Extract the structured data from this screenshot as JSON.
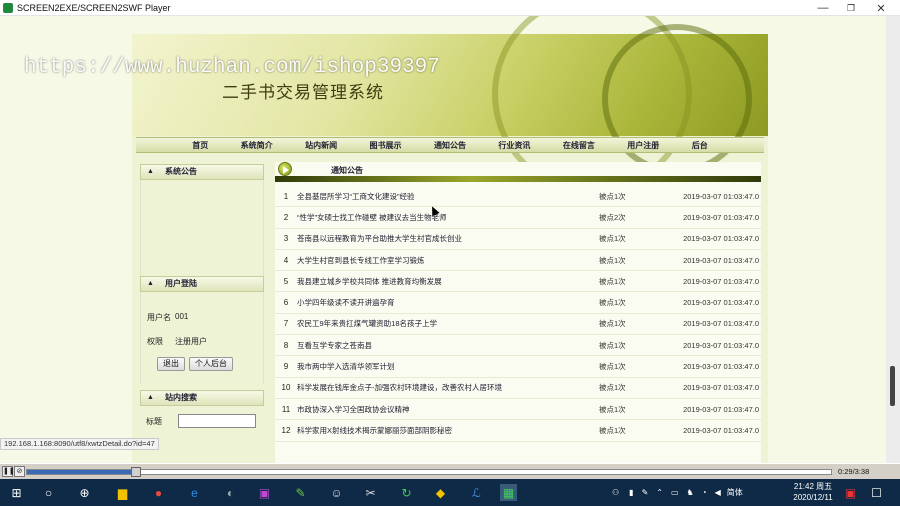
{
  "window": {
    "title": "SCREEN2EXE/SCREEN2SWF Player",
    "minimize": "—",
    "restore": "❐",
    "close": "✕"
  },
  "watermark": "https://www.huzhan.com/ishop39397",
  "site": {
    "title": "二手书交易管理系统"
  },
  "nav": [
    "首页",
    "系统简介",
    "站内新闻",
    "图书展示",
    "通知公告",
    "行业资讯",
    "在线留言",
    "用户注册",
    "后台"
  ],
  "sidebar": {
    "notice_title": "系统公告",
    "login_title": "用户登陆",
    "user_label": "用户名",
    "user_value": "001",
    "role_label": "权限",
    "role_value": "注册用户",
    "logout_button": "退出",
    "personal_button": "个人后台",
    "search_title": "站内搜索",
    "search_label": "标题"
  },
  "main": {
    "title": "通知公告",
    "rows": [
      {
        "n": "1",
        "title": "全县基层所学习“工商文化建设”经验",
        "clicks": "被点1次",
        "date": "2019-03-07 01:03:47.0"
      },
      {
        "n": "2",
        "title": "“性学”女硕士找工作碰壁 被建议去当生物老师",
        "clicks": "被点2次",
        "date": "2019-03-07 01:03:47.0"
      },
      {
        "n": "3",
        "title": "苍南县以远程教育为平台助推大学生村官成长创业",
        "clicks": "被点1次",
        "date": "2019-03-07 01:03:47.0"
      },
      {
        "n": "4",
        "title": "大学生村官到县长专线工作室学习锻炼",
        "clicks": "被点1次",
        "date": "2019-03-07 01:03:47.0"
      },
      {
        "n": "5",
        "title": "我县建立城乡学校共同体 推进教育均衡发展",
        "clicks": "被点1次",
        "date": "2019-03-07 01:03:47.0"
      },
      {
        "n": "6",
        "title": "小学四年级读不读开讲遍孕育",
        "clicks": "被点1次",
        "date": "2019-03-07 01:03:47.0"
      },
      {
        "n": "7",
        "title": "农民工9年来贵扛煤气罐资助18名孩子上学",
        "clicks": "被点1次",
        "date": "2019-03-07 01:03:47.0"
      },
      {
        "n": "8",
        "title": "互看互学专家之苍南县",
        "clicks": "被点1次",
        "date": "2019-03-07 01:03:47.0"
      },
      {
        "n": "9",
        "title": "我市两中学入选清华领军计划",
        "clicks": "被点1次",
        "date": "2019-03-07 01:03:47.0"
      },
      {
        "n": "10",
        "title": "科学发展在钱库金点子-加强农村环境建设，改善农村人居环境",
        "clicks": "被点1次",
        "date": "2019-03-07 01:03:47.0"
      },
      {
        "n": "11",
        "title": "市政协深入学习全国政协会议精神",
        "clicks": "被点1次",
        "date": "2019-03-07 01:03:47.0"
      },
      {
        "n": "12",
        "title": "科学家用X射线技术揭示蒙娜丽莎面部阴影秘密",
        "clicks": "被点1次",
        "date": "2019-03-07 01:03:47.0"
      }
    ]
  },
  "status_url": "192.168.1.168:8090/utf8/xwtzDetail.do?id=47",
  "player": {
    "time": "0:29/3:38",
    "progress": 0.135
  },
  "taskbar": {
    "ime": "简体",
    "time": "21:42 周五",
    "date": "2020/12/11"
  }
}
